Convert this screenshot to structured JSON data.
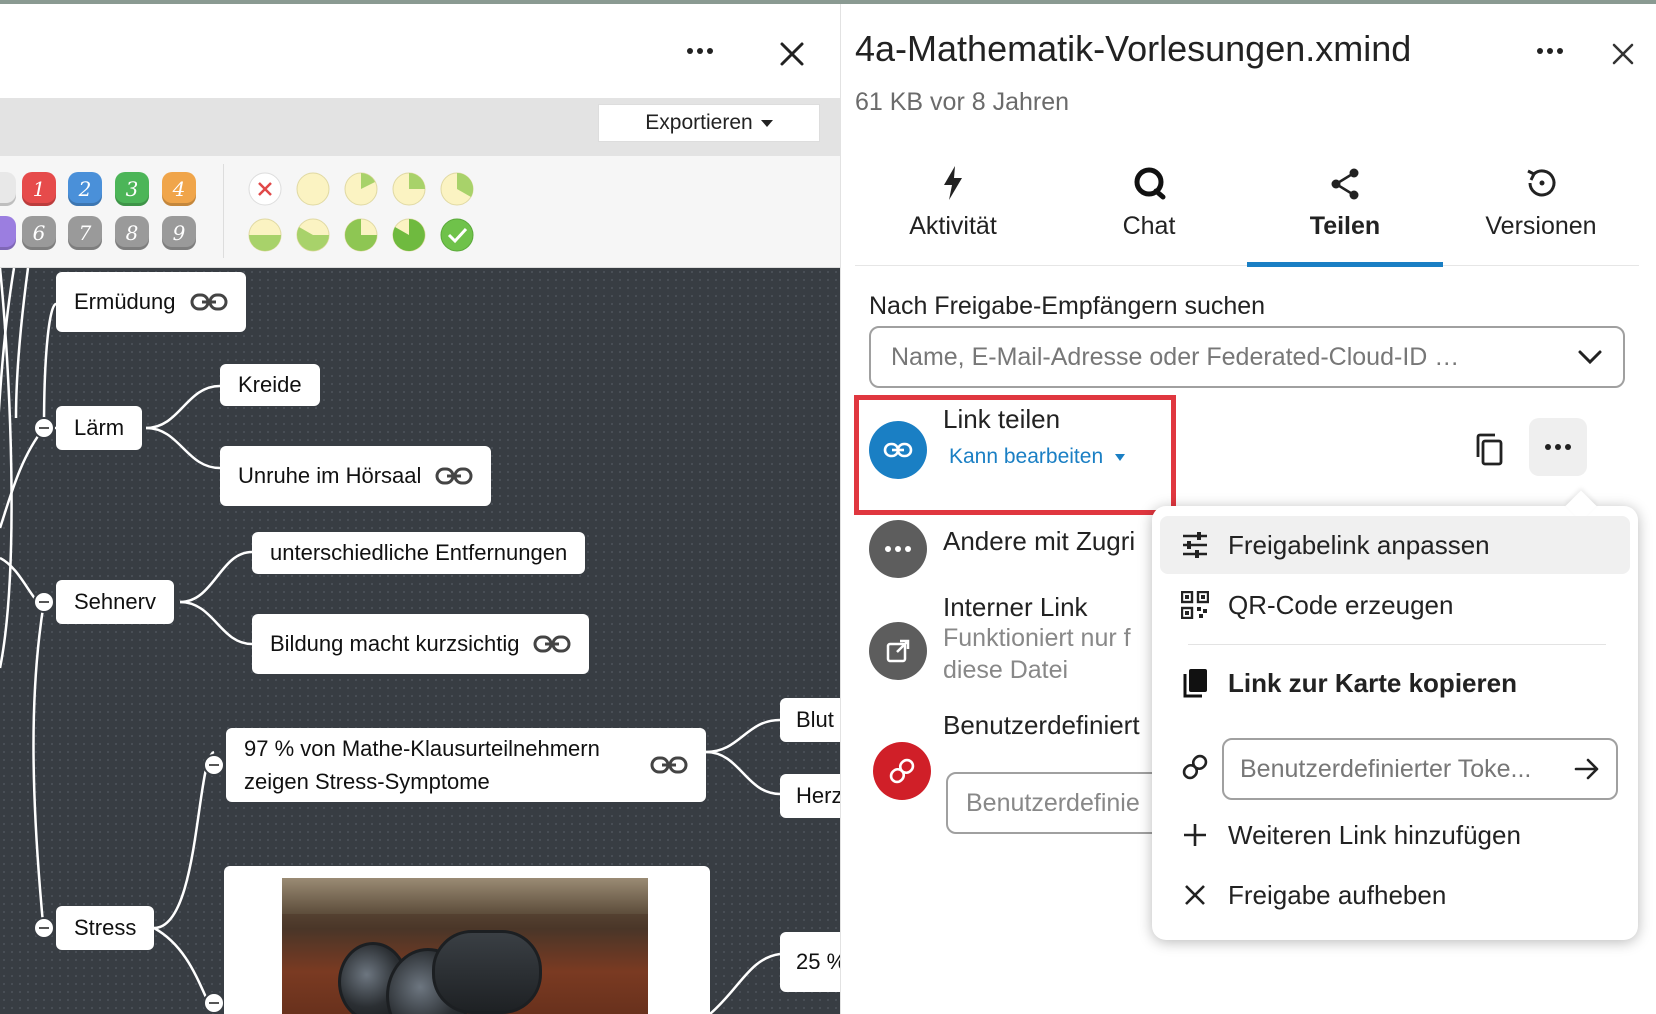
{
  "colors": {
    "accent": "#1a7fc4",
    "highlight": "#e0373f",
    "avatar_link": "#1a7fc4",
    "avatar_grey": "#5d5d5d",
    "avatar_red": "#d01f28",
    "canvas": "#383d43"
  },
  "left_toolbar": {
    "export_label": "Exportieren",
    "markers_row1": [
      "1",
      "2",
      "3",
      "4"
    ],
    "markers_row2": [
      "6",
      "7",
      "8",
      "9"
    ]
  },
  "mindmap": {
    "nodes": {
      "ermuedung": "Ermüdung",
      "laerm": "Lärm",
      "kreide": "Kreide",
      "unruhe": "Unruhe im Hörsaal",
      "sehnerv": "Sehnerv",
      "entfernungen": "unterschiedliche Entfernungen",
      "bildung": "Bildung macht kurzsichtig",
      "klausur_line1": "97 % von Mathe-Klausurteilnehmern",
      "klausur_line2": "zeigen Stress-Symptome",
      "blut": "Blut",
      "herz": "Herz",
      "stress": "Stress",
      "prozent": "25 %"
    }
  },
  "sidebar": {
    "file_title": "4a-Mathematik-Vorlesungen.xmind",
    "file_meta": "61 KB vor 8 Jahren",
    "tabs": [
      {
        "label": "Aktivität",
        "icon": "lightning-icon"
      },
      {
        "label": "Chat",
        "icon": "chat-icon"
      },
      {
        "label": "Teilen",
        "icon": "share-icon",
        "active": true
      },
      {
        "label": "Versionen",
        "icon": "history-icon"
      }
    ],
    "search_label": "Nach Freigabe-Empfängern suchen",
    "search_placeholder": "Name, E-Mail-Adresse oder Federated-Cloud-ID …",
    "link_share": {
      "title": "Link teilen",
      "permission": "Kann bearbeiten"
    },
    "others_with_access": "Andere mit Zugri",
    "internal_link": {
      "title": "Interner Link",
      "sub_line1": "Funktioniert nur f",
      "sub_line2": "diese Datei"
    },
    "custom_share": {
      "title": "Benutzerdefiniert",
      "placeholder": "Benutzerdefinie"
    }
  },
  "menu": {
    "items": [
      {
        "label": "Freigabelink anpassen",
        "icon": "sliders-icon"
      },
      {
        "label": "QR-Code erzeugen",
        "icon": "qr-code-icon"
      },
      {
        "label": "Link zur Karte kopieren",
        "icon": "copy-card-icon"
      },
      {
        "label": "Weiteren Link hinzufügen",
        "icon": "plus-icon"
      },
      {
        "label": "Freigabe aufheben",
        "icon": "close-icon"
      }
    ],
    "token_placeholder": "Benutzerdefinierter Toke..."
  }
}
